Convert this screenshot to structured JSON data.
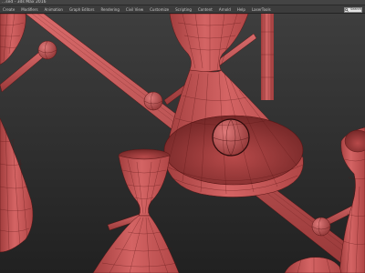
{
  "window": {
    "title": "...sed - 3ds Max 2016"
  },
  "menu": {
    "items": [
      "Create",
      "Modifiers",
      "Animation",
      "Graph Editors",
      "Rendering",
      "Civil View",
      "Customize",
      "Scripting",
      "Content",
      "Arnold",
      "Help",
      "LaserTools"
    ]
  },
  "search": {
    "placeholder": "Search"
  },
  "viewport": {
    "colors": {
      "shade": "#c65454",
      "wire": "#5a1616",
      "background_top": "#3e3e3e",
      "background_bottom": "#212121"
    }
  }
}
